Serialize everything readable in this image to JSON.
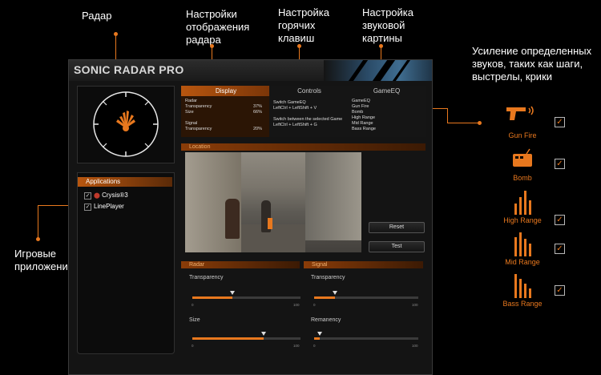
{
  "callouts": {
    "radar": "Радар",
    "display_settings": "Настройки\nотображения\nрадара",
    "hotkeys": "Настройка\nгорячих\nклавиш",
    "sound_picture": "Настройка\nзвуковой\nкартины",
    "amplify": "Усиление определенных\nзвуков, таких как шаги,\nвыстрелы, крики",
    "game_apps": "Игровые\nприложения"
  },
  "window": {
    "title": "SONIC RADAR PRO"
  },
  "tabs": {
    "display": {
      "label": "Display",
      "lines": "Radar\nTransparency\nSize\n\nSignal\nTransparency",
      "values": [
        "37%",
        "66%",
        "20%"
      ]
    },
    "controls": {
      "label": "Controls",
      "lines": "Switch GameEQ\nLeftCtrl + LeftShift + V\n\nSwitch between the selected Game\nLeftCtrl + LeftShift + G"
    },
    "gameeq": {
      "label": "GameEQ",
      "lines": "GameEQ\nGun Fire\nBomb\nHigh Range\nMid Range\nBass Range"
    }
  },
  "applications": {
    "header": "Applications",
    "items": [
      {
        "name": "Crysis®3",
        "checked": true
      },
      {
        "name": "LinePlayer",
        "checked": true
      }
    ]
  },
  "location": {
    "header": "Location",
    "reset_label": "Reset",
    "test_label": "Test"
  },
  "radar_panel": {
    "header": "Radar",
    "transparency_label": "Transparency",
    "transparency_value": 0.37,
    "size_label": "Size",
    "size_value": 0.66
  },
  "signal_panel": {
    "header": "Signal",
    "transparency_label": "Transparency",
    "transparency_value": 0.2,
    "remanency_label": "Remanency",
    "remanency_value": 0.05
  },
  "ticks": {
    "min": "0",
    "max": "100"
  },
  "sounds": [
    {
      "label": "Gun Fire",
      "icon": "gun-icon",
      "checked": true
    },
    {
      "label": "Bomb",
      "icon": "bomb-icon",
      "checked": true
    },
    {
      "label": "High Range",
      "icon": "high-range-bars-icon",
      "checked": true
    },
    {
      "label": "Mid Range",
      "icon": "mid-range-bars-icon",
      "checked": true
    },
    {
      "label": "Bass Range",
      "icon": "bass-range-bars-icon",
      "checked": true
    }
  ],
  "colors": {
    "accent": "#e8781e",
    "background": "#000000",
    "panel": "#141414"
  },
  "check_mark": "✓"
}
